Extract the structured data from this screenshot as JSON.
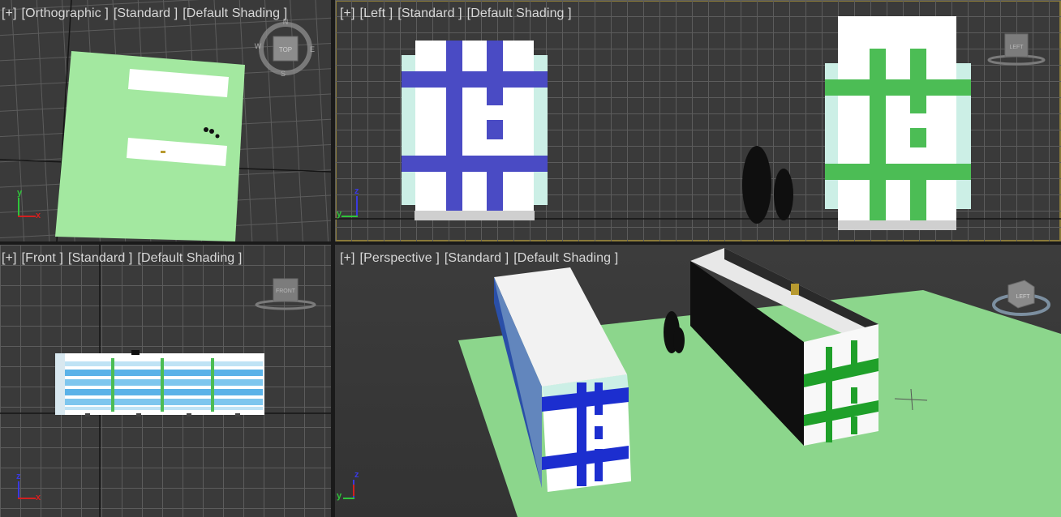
{
  "viewports": {
    "top": {
      "menu": "[+]",
      "view": "[Orthographic ]",
      "quality": "[Standard ]",
      "shading": "[Default Shading ]",
      "cube_face": "TOP",
      "compass": {
        "n": "N",
        "e": "E",
        "s": "S",
        "w": "W"
      },
      "axes": {
        "a": "y",
        "b": "x"
      }
    },
    "left": {
      "menu": "[+]",
      "view": "[Left ]",
      "quality": "[Standard ]",
      "shading": "[Default Shading ]",
      "cube_face": "LEFT",
      "axes": {
        "a": "z",
        "b": "y"
      }
    },
    "front": {
      "menu": "[+]",
      "view": "[Front ]",
      "quality": "[Standard ]",
      "shading": "[Default Shading ]",
      "cube_face": "FRONT",
      "axes": {
        "a": "z",
        "b": "x"
      }
    },
    "perspective": {
      "menu": "[+]",
      "view": "[Perspective ]",
      "quality": "[Standard ]",
      "shading": "[Default Shading ]",
      "cube_face": "LEFT",
      "axes": {
        "a": "z",
        "b": "y"
      }
    }
  },
  "colors": {
    "grass": "#a3e8a0",
    "blue_stripe": "#4a4bc4",
    "green_stripe": "#4cbd55",
    "balcony": "#ccefe6",
    "axis_x": "#d22020",
    "axis_y": "#2fc43a",
    "axis_z": "#3a3ae0"
  }
}
